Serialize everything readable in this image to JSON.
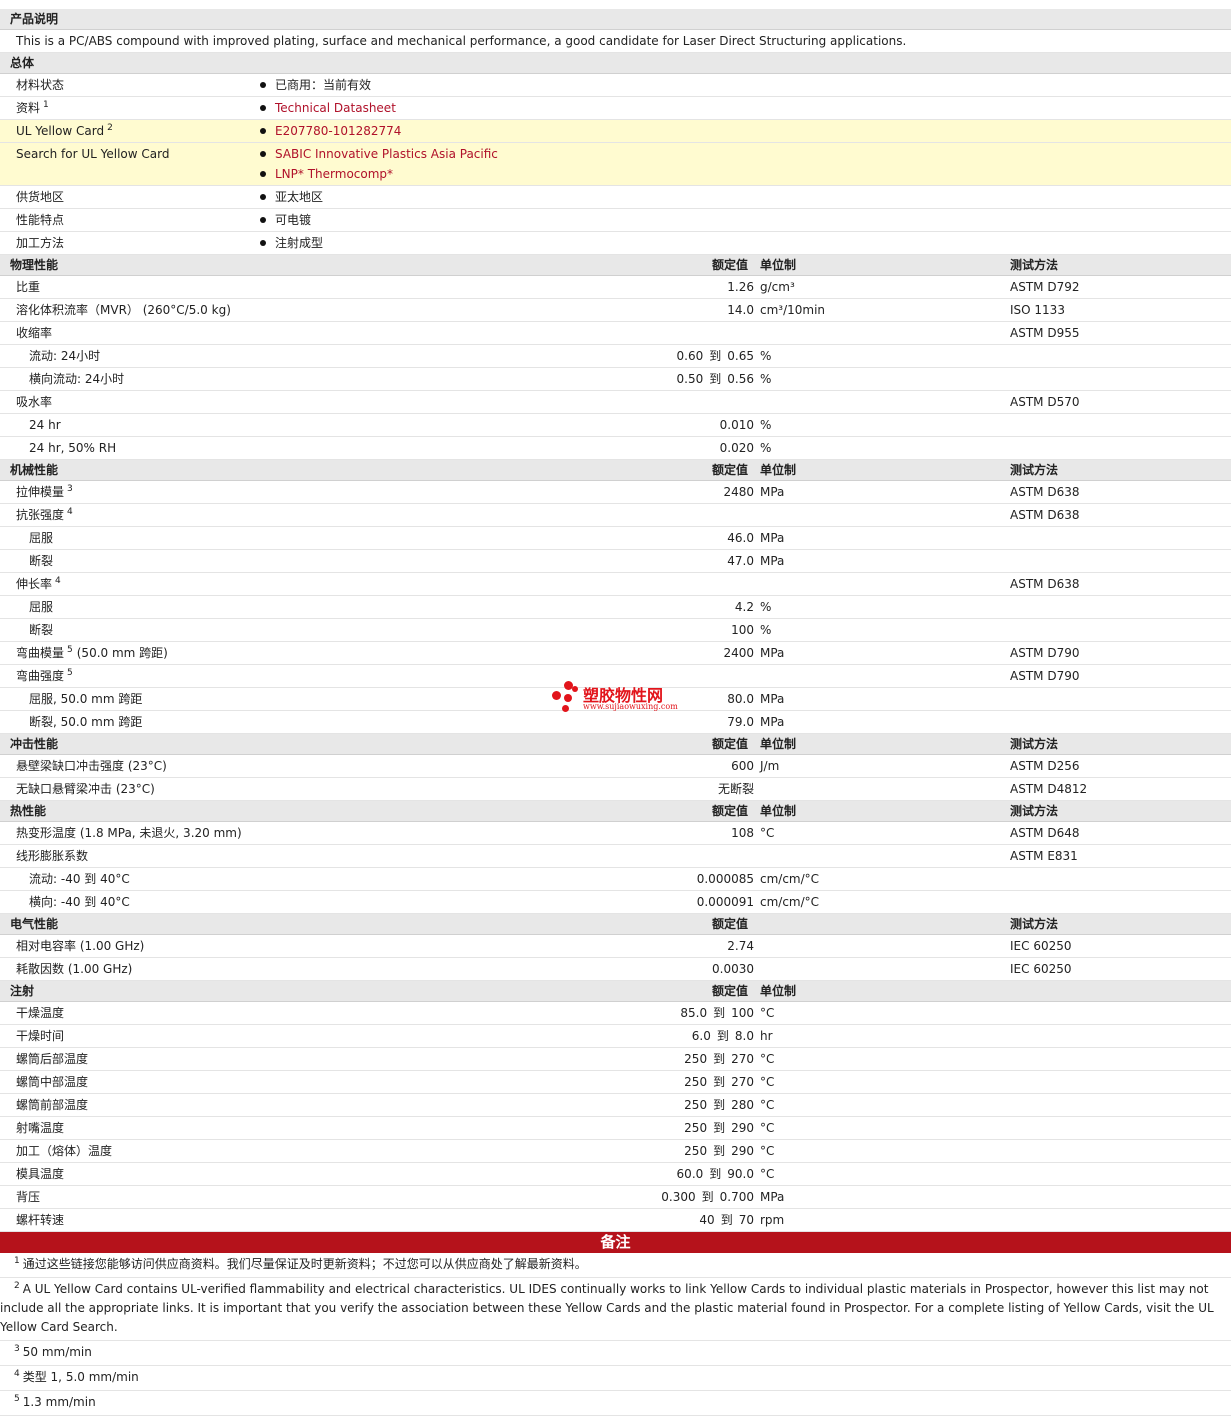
{
  "description_section": {
    "title": "产品说明",
    "text": "This is a PC/ABS compound with improved plating, surface and mechanical performance, a good candidate for Laser Direct Structuring applications."
  },
  "general": {
    "title": "总体",
    "rows": [
      {
        "label": "材料状态",
        "values": [
          "已商用：当前有效"
        ],
        "links": false
      },
      {
        "label": "资料",
        "sup": "1",
        "values": [
          "Technical Datasheet"
        ],
        "links": true
      },
      {
        "label": "UL Yellow Card",
        "sup": "2",
        "values": [
          "E207780-101282774"
        ],
        "links": true,
        "yellow": true
      },
      {
        "label": "Search for UL Yellow Card",
        "values": [
          "SABIC Innovative Plastics Asia Pacific",
          "LNP* Thermocomp*"
        ],
        "links": true,
        "yellow": true
      },
      {
        "label": "供货地区",
        "values": [
          "亚太地区"
        ],
        "links": false
      },
      {
        "label": "性能特点",
        "values": [
          "可电镀"
        ],
        "links": false
      },
      {
        "label": "加工方法",
        "values": [
          "注射成型"
        ],
        "links": false
      }
    ]
  },
  "header_labels": {
    "rated": "额定值",
    "unit": "单位制",
    "method": "测试方法"
  },
  "sections": [
    {
      "title": "物理性能",
      "show_unit": true,
      "show_method": true,
      "rows": [
        {
          "label": "比重",
          "value": "1.26",
          "unit": "g/cm³",
          "method": "ASTM D792"
        },
        {
          "label": "溶化体积流率（MVR） (260°C/5.0 kg)",
          "value": "14.0",
          "unit": "cm³/10min",
          "method": "ISO 1133"
        },
        {
          "label": "收缩率",
          "method": "ASTM D955"
        },
        {
          "label": "流动: 24小时",
          "sub": true,
          "from": "0.60",
          "to": "0.65",
          "unit": "%"
        },
        {
          "label": "横向流动: 24小时",
          "sub": true,
          "from": "0.50",
          "to": "0.56",
          "unit": "%"
        },
        {
          "label": "吸水率",
          "method": "ASTM D570"
        },
        {
          "label": "24 hr",
          "sub": true,
          "value": "0.010",
          "unit": "%"
        },
        {
          "label": "24 hr, 50% RH",
          "sub": true,
          "value": "0.020",
          "unit": "%"
        }
      ]
    },
    {
      "title": "机械性能",
      "show_unit": true,
      "show_method": true,
      "rows": [
        {
          "label": "拉伸模量",
          "sup": "3",
          "value": "2480",
          "unit": "MPa",
          "method": "ASTM D638"
        },
        {
          "label": "抗张强度",
          "sup": "4",
          "method": "ASTM D638"
        },
        {
          "label": "屈服",
          "sub": true,
          "value": "46.0",
          "unit": "MPa"
        },
        {
          "label": "断裂",
          "sub": true,
          "value": "47.0",
          "unit": "MPa"
        },
        {
          "label": "伸长率",
          "sup": "4",
          "method": "ASTM D638"
        },
        {
          "label": "屈服",
          "sub": true,
          "value": "4.2",
          "unit": "%"
        },
        {
          "label": "断裂",
          "sub": true,
          "value": "100",
          "unit": "%"
        },
        {
          "label": "弯曲模量",
          "sup": "5",
          "extra": "(50.0 mm 跨距)",
          "value": "2400",
          "unit": "MPa",
          "method": "ASTM D790"
        },
        {
          "label": "弯曲强度",
          "sup": "5",
          "method": "ASTM D790"
        },
        {
          "label": "屈服, 50.0 mm 跨距",
          "sub": true,
          "value": "80.0",
          "unit": "MPa"
        },
        {
          "label": "断裂, 50.0 mm 跨距",
          "sub": true,
          "value": "79.0",
          "unit": "MPa"
        }
      ]
    },
    {
      "title": "冲击性能",
      "show_unit": true,
      "show_method": true,
      "rows": [
        {
          "label": "悬壁梁缺口冲击强度 (23°C)",
          "value": "600",
          "unit": "J/m",
          "method": "ASTM D256"
        },
        {
          "label": "无缺口悬臂梁冲击 (23°C)",
          "value": "无断裂",
          "method": "ASTM D4812"
        }
      ]
    },
    {
      "title": "热性能",
      "show_unit": true,
      "show_method": true,
      "rows": [
        {
          "label": "热变形温度 (1.8 MPa, 未退火, 3.20 mm)",
          "value": "108",
          "unit": "°C",
          "method": "ASTM D648"
        },
        {
          "label": "线形膨胀系数",
          "method": "ASTM E831"
        },
        {
          "label": "流动: -40 到  40°C",
          "sub": true,
          "value": "0.000085",
          "unit": "cm/cm/°C"
        },
        {
          "label": "横向: -40 到  40°C",
          "sub": true,
          "value": "0.000091",
          "unit": "cm/cm/°C"
        }
      ]
    },
    {
      "title": "电气性能",
      "show_unit": false,
      "show_method": true,
      "rows": [
        {
          "label": "相对电容率 (1.00 GHz)",
          "value": "2.74",
          "method": "IEC 60250"
        },
        {
          "label": "耗散因数 (1.00 GHz)",
          "value": "0.0030",
          "method": "IEC 60250"
        }
      ]
    },
    {
      "title": "注射",
      "show_unit": true,
      "show_method": false,
      "rows": [
        {
          "label": "干燥温度",
          "from": "85.0",
          "to": "100",
          "unit": "°C"
        },
        {
          "label": "干燥时间",
          "from": "6.0",
          "to": "8.0",
          "unit": "hr"
        },
        {
          "label": "螺筒后部温度",
          "from": "250",
          "to": "270",
          "unit": "°C"
        },
        {
          "label": "螺筒中部温度",
          "from": "250",
          "to": "270",
          "unit": "°C"
        },
        {
          "label": "螺筒前部温度",
          "from": "250",
          "to": "280",
          "unit": "°C"
        },
        {
          "label": "射嘴温度",
          "from": "250",
          "to": "290",
          "unit": "°C"
        },
        {
          "label": "加工（熔体）温度",
          "from": "250",
          "to": "290",
          "unit": "°C"
        },
        {
          "label": "模具温度",
          "from": "60.0",
          "to": "90.0",
          "unit": "°C"
        },
        {
          "label": "背压",
          "from": "0.300",
          "to": "0.700",
          "unit": "MPa"
        },
        {
          "label": "螺杆转速",
          "from": "40",
          "to": "70",
          "unit": "rpm"
        }
      ]
    }
  ],
  "range_word": "到",
  "notes": {
    "title": "备注",
    "items": [
      {
        "num": "1",
        "text": "通过这些链接您能够访问供应商资料。我们尽量保证及时更新资料；不过您可以从供应商处了解最新资料。"
      },
      {
        "num": "2",
        "text": "A UL Yellow Card contains UL-verified flammability and electrical characteristics. UL IDES continually works to link Yellow Cards to individual plastic materials in Prospector, however this list may not include all the appropriate links. It is important that you verify the association between these Yellow Cards and the plastic material found in Prospector. For a complete listing of Yellow Cards, visit the UL Yellow Card Search."
      },
      {
        "num": "3",
        "text": "50 mm/min"
      },
      {
        "num": "4",
        "text": "类型  1, 5.0 mm/min"
      },
      {
        "num": "5",
        "text": "1.3 mm/min"
      }
    ]
  },
  "watermark": {
    "name": "塑胶物性网",
    "url": "www.sujiaowuxing.com"
  },
  "colors": {
    "header_bg": "#e8e8e8",
    "link": "#b0112a",
    "yellow_row": "#fffbd0",
    "notes_bar": "#b5121b",
    "watermark": "#e2141b"
  }
}
